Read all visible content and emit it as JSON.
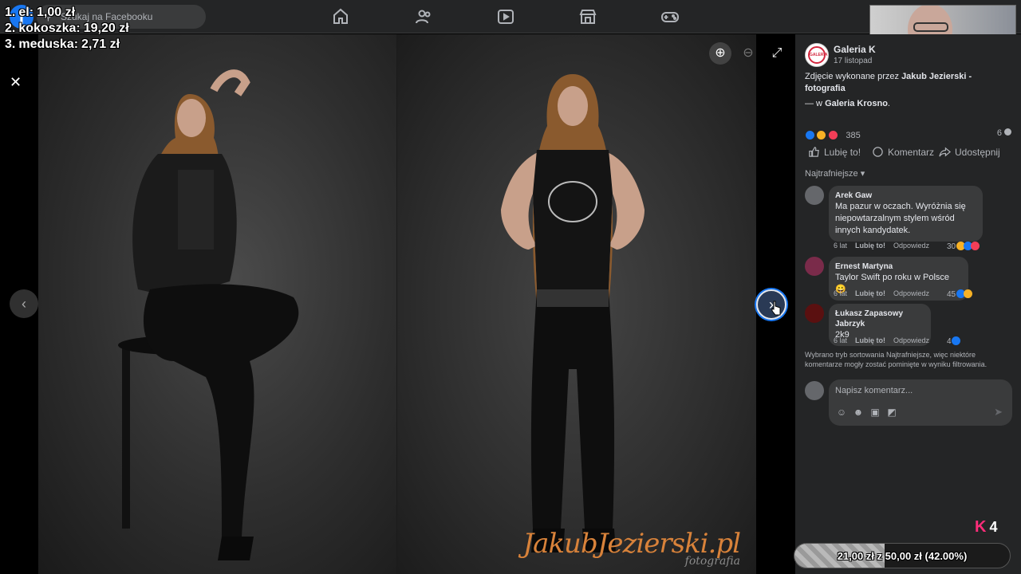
{
  "overlay": {
    "rows": [
      {
        "prefix": "1.",
        "name": "el:",
        "amount": "1,00 zł"
      },
      {
        "prefix": "2.",
        "name": "kokoszka:",
        "amount": "19,20 zł"
      },
      {
        "prefix": "3.",
        "name": "meduska:",
        "amount": "2,71 zł"
      }
    ]
  },
  "topbar": {
    "search_placeholder": "Szukaj na Facebooku",
    "nav_icons": [
      "home-icon",
      "friends-icon",
      "watch-icon",
      "marketplace-icon",
      "gaming-icon"
    ]
  },
  "viewer": {
    "watermark": "JakubJezierski.pl",
    "watermark_sub": "fotografia"
  },
  "post": {
    "page_name": "Galeria K",
    "date": "17 listopad",
    "caption_prefix": "Zdjęcie wykonane przez ",
    "caption_author": "Jakub Jezierski - fotografia",
    "location_prefix": "— w ",
    "location": "Galeria Krosno",
    "location_suffix": ".",
    "reactions_count": "385",
    "comments_count": "6",
    "actions": {
      "like": "Lubię to!",
      "comment": "Komentarz",
      "share": "Udostępnij"
    },
    "sort_label": "Najtrafniejsze"
  },
  "comments": [
    {
      "author": "Arek Gaw",
      "text": "Ma pazur w oczach. Wyróżnia się niepowtarzalnym stylem wśród innych kandydatek.",
      "age": "6 lat",
      "like": "Lubię to!",
      "reply": "Odpowiedz",
      "reactions": "30"
    },
    {
      "author": "Ernest Martyna",
      "text": "Taylor Swift po roku w Polsce 😀",
      "age": "6 lat",
      "like": "Lubię to!",
      "reply": "Odpowiedz",
      "reactions": "45"
    },
    {
      "author": "Łukasz Zapasowy Jabrzyk",
      "text": "2k9",
      "age": "6 lat",
      "like": "Lubię to!",
      "reply": "Odpowiedz",
      "reactions": "4"
    }
  ],
  "filter_note": "Wybrano tryb sortowania Najtrafniejsze, więc niektóre komentarze mogły zostać pominięte w wyniku filtrowania.",
  "composer": {
    "placeholder": "Napisz komentarz..."
  },
  "stream": {
    "badge_count": "4",
    "badge_letter": "K",
    "progress_text": "21,00 zł z 50,00 zł (42.00%)",
    "progress_fraction": 0.42
  },
  "colors": {
    "facebook_blue": "#1877f2",
    "panel_bg": "#242526",
    "like_blue": "#1877f2",
    "love_red": "#f33e58",
    "haha_yellow": "#f7b125"
  }
}
